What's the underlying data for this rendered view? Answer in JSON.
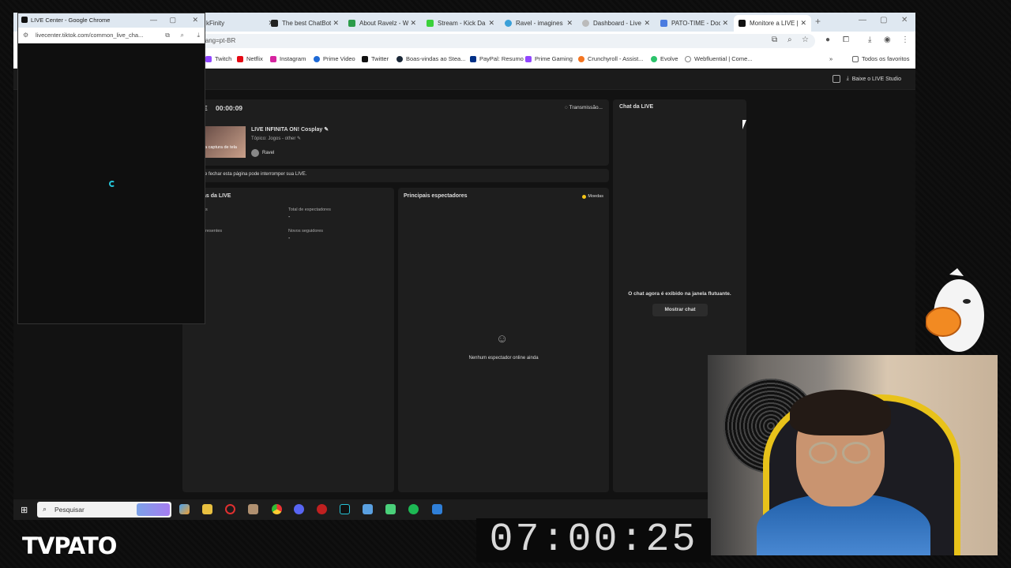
{
  "tabs": [
    "kFinity",
    "The best ChatBot",
    "About Ravelz - W",
    "Stream - Kick Da",
    "Ravel - imagines",
    "Dashboard - Live",
    "PATO-TIME - Doc",
    "Monitore a LIVE |"
  ],
  "address": "lang=pt-BR",
  "bookmarks": [
    "Twitch",
    "Netflix",
    "Instagram",
    "Prime Video",
    "Twitter",
    "Boas-vindas ao Stea...",
    "PayPal: Resumo",
    "Prime Gaming",
    "Crunchyroll - Assist...",
    "Evolve",
    "Webfluential | Come..."
  ],
  "all_favorites": "Todos os favoritos",
  "studio_button": "Baixe o LIVE Studio",
  "live": {
    "timer_prefix": "E",
    "elapsed": "00:00:09",
    "status": "Transmissão...",
    "title": "LIVE INFINITA ON! Cosplay",
    "topic": "Tópico: Jogos - other",
    "user": "Ravel",
    "thumb_text": "a captura de tela",
    "warning": "e fechar esta página pode interromper sua LIVE."
  },
  "stats": {
    "title": "as da LIVE",
    "labels": [
      "es",
      "Total de espectadores",
      "presentes",
      "Novos seguidores"
    ],
    "values": [
      "",
      "-",
      "",
      "-"
    ]
  },
  "viewers": {
    "title": "Principais espectadores",
    "coins": "Moedas",
    "empty": "Nenhum espectador online ainda"
  },
  "chat": {
    "title": "Chat da LIVE",
    "message": "O chat agora é exibido na janela flutuante.",
    "button": "Mostrar chat"
  },
  "float": {
    "title": "LIVE Center - Google Chrome",
    "url": "livecenter.tiktok.com/common_live_cha..."
  },
  "taskbar": {
    "search_placeholder": "Pesquisar"
  },
  "overlay": {
    "clock": "07:00:25",
    "logo": "TVPATO"
  },
  "colors": {
    "accent": "#25c4d8",
    "coin": "#f5c518"
  }
}
